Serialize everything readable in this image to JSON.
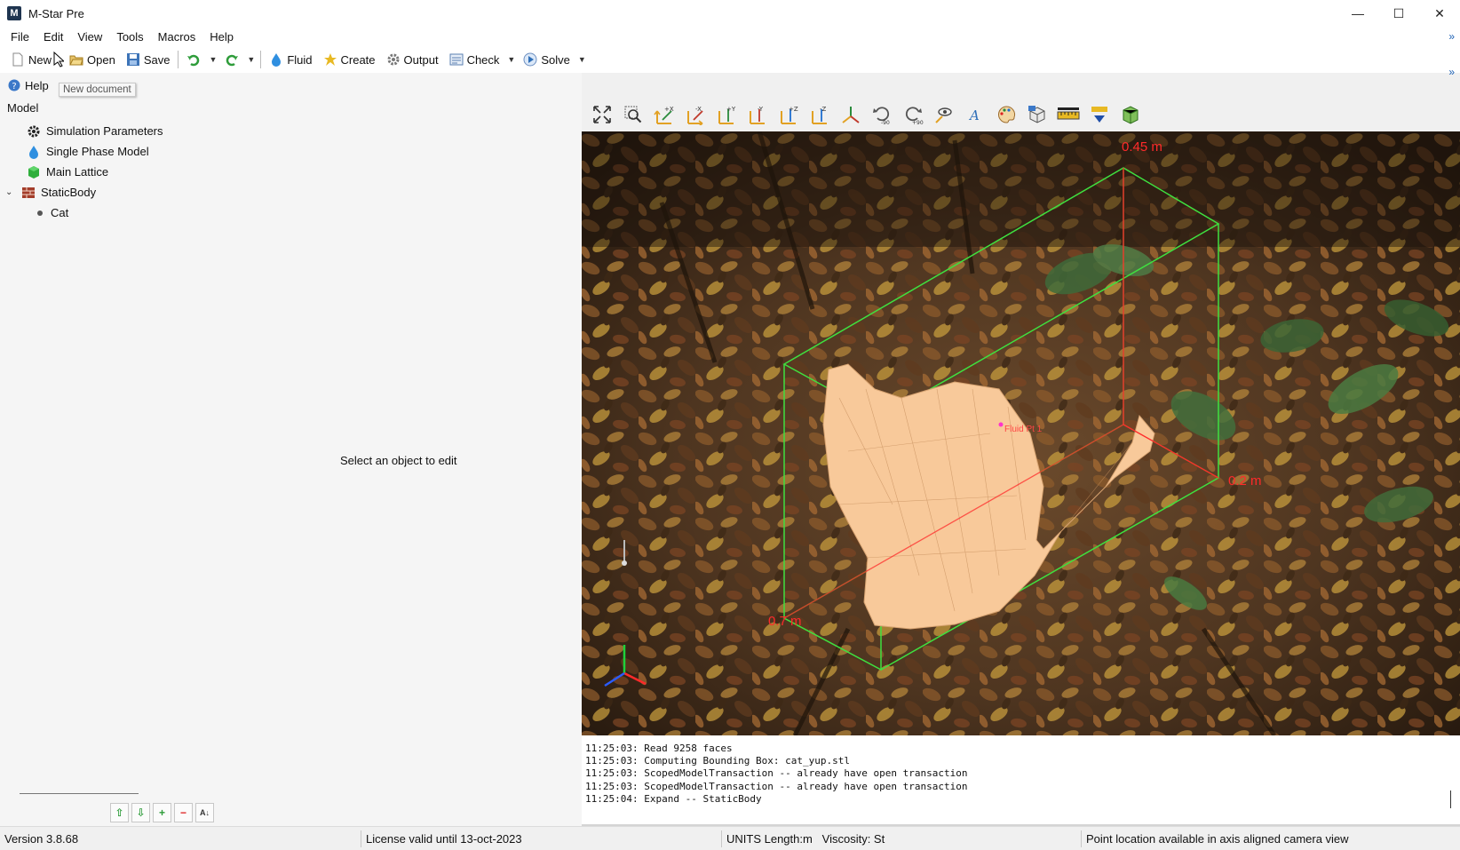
{
  "window": {
    "title": "M-Star Pre",
    "app_icon_letter": "M",
    "controls": {
      "minimize": "—",
      "maximize": "☐",
      "close": "✕"
    }
  },
  "menu": [
    "File",
    "Edit",
    "View",
    "Tools",
    "Macros",
    "Help"
  ],
  "toolbar": {
    "new": "New",
    "open": "Open",
    "save": "Save",
    "fluid": "Fluid",
    "create": "Create",
    "output": "Output",
    "check": "Check",
    "solve": "Solve"
  },
  "tooltip": "New document",
  "left_panel": {
    "help": "Help",
    "model_label": "Model",
    "tree": [
      {
        "label": "Simulation Parameters",
        "icon": "gear-icon"
      },
      {
        "label": "Single Phase Model",
        "icon": "droplet-icon"
      },
      {
        "label": "Main Lattice",
        "icon": "cube-icon"
      },
      {
        "label": "StaticBody",
        "icon": "bricks-icon"
      },
      {
        "label": "Cat",
        "icon": "dot-icon"
      }
    ],
    "placeholder": "Select an object to edit"
  },
  "viewport": {
    "dim_labels": {
      "top": "0.45 m",
      "right": "0.2 m",
      "left": "0.7 m"
    },
    "point_label": "Fluid Pt 1",
    "colors": {
      "bbox": "#3fe03f",
      "mesh": "#f8c99a",
      "axis_red": "#ff2a2a"
    }
  },
  "log": [
    "11:25:03: Read 9258 faces",
    "11:25:03: Computing Bounding Box: cat_yup.stl",
    "11:25:03: ScopedModelTransaction -- already have open transaction",
    "11:25:03: ScopedModelTransaction -- already have open transaction",
    "11:25:04: Expand -- StaticBody"
  ],
  "status": {
    "version": "Version 3.8.68",
    "license": "License valid until 13-oct-2023",
    "units": "UNITS Length:m   Viscosity: St",
    "hint": "Point location available in axis aligned camera view"
  }
}
